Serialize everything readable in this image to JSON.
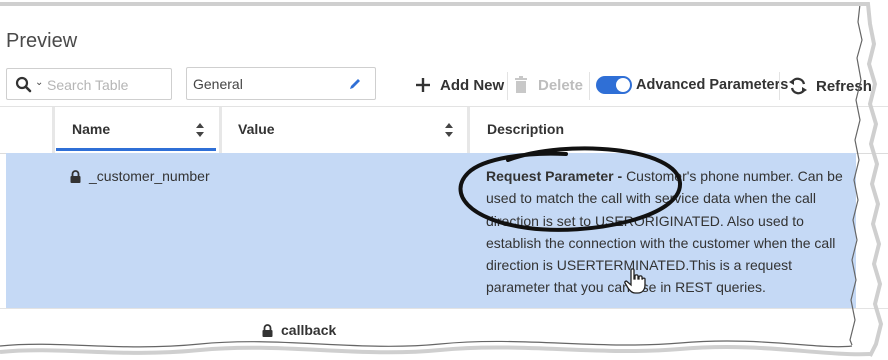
{
  "page": {
    "title": "Preview"
  },
  "search": {
    "placeholder": "Search Table"
  },
  "filter": {
    "value": "General"
  },
  "toolbar": {
    "add_new": "Add New",
    "delete": "Delete",
    "advanced": "Advanced Parameters",
    "refresh": "Refresh",
    "advanced_enabled": true
  },
  "table": {
    "columns": [
      "Name",
      "Value",
      "Description"
    ],
    "rows": [
      {
        "name": "_customer_number",
        "value": "",
        "description_bold": "Request Parameter - ",
        "description": "Customer's phone number. Can be used to match the call with service data when the call direction is set to USERORIGINATED. Also used to establish the connection with the customer when the call direction is USERTERMINATED.This is a request parameter that you can use in REST queries.",
        "locked": true,
        "selected": true
      },
      {
        "name": "callback",
        "locked": true
      }
    ]
  },
  "colors": {
    "accent": "#2f6fd6",
    "selected_row": "#c5d9f5"
  }
}
